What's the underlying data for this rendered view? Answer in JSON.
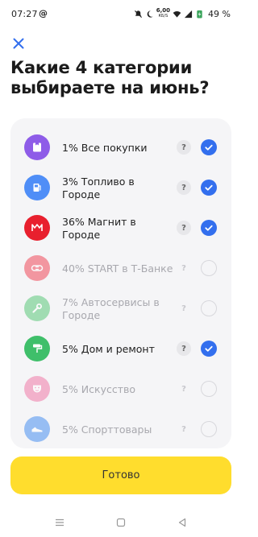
{
  "status_bar": {
    "time": "07:27",
    "notification_symbol": "@",
    "network_speed_value": "6,00",
    "network_speed_unit": "КБ/S",
    "battery_percent": "49 %",
    "icons": [
      "silent-mode-icon",
      "do-not-disturb-icon",
      "wifi-icon",
      "signal-icon",
      "battery-saver-icon"
    ]
  },
  "header": {
    "close_icon": "close-icon",
    "title": "Какие 4 категории выбираете на июнь?"
  },
  "categories": [
    {
      "label": "1% Все покупки",
      "icon": "shopping-bag-icon",
      "icon_color": "#8e5ce8",
      "help": "?",
      "checked": true,
      "enabled": true
    },
    {
      "label": "3% Топливо в Городе",
      "icon": "fuel-pump-icon",
      "icon_color": "#4f8ef7",
      "help": "?",
      "checked": true,
      "enabled": true
    },
    {
      "label": "36% Магнит в Городе",
      "icon": "magnit-logo-icon",
      "icon_color": "#e8202e",
      "help": "?",
      "checked": true,
      "enabled": true
    },
    {
      "label": "40% START в Т-Банке",
      "icon": "start-logo-icon",
      "icon_color": "#f04a5a",
      "help": "?",
      "checked": false,
      "enabled": false
    },
    {
      "label": "7% Автосервисы в Городе",
      "icon": "wrench-icon",
      "icon_color": "#5cc87a",
      "help": "?",
      "checked": false,
      "enabled": false
    },
    {
      "label": "5% Дом и ремонт",
      "icon": "paint-roller-icon",
      "icon_color": "#3fbf6a",
      "help": "?",
      "checked": true,
      "enabled": true
    },
    {
      "label": "5% Искусство",
      "icon": "theater-mask-icon",
      "icon_color": "#f07aa8",
      "help": "?",
      "checked": false,
      "enabled": false
    },
    {
      "label": "5% Спорттовары",
      "icon": "sneaker-icon",
      "icon_color": "#4a90f0",
      "help": "?",
      "checked": false,
      "enabled": false
    }
  ],
  "actions": {
    "done_label": "Готово"
  },
  "colors": {
    "accent_blue": "#336fee",
    "primary_yellow": "#ffdd2d",
    "card_background": "#f5f5f7"
  },
  "system_nav": {
    "icons": [
      "recent-apps-icon",
      "home-icon",
      "back-icon"
    ]
  }
}
